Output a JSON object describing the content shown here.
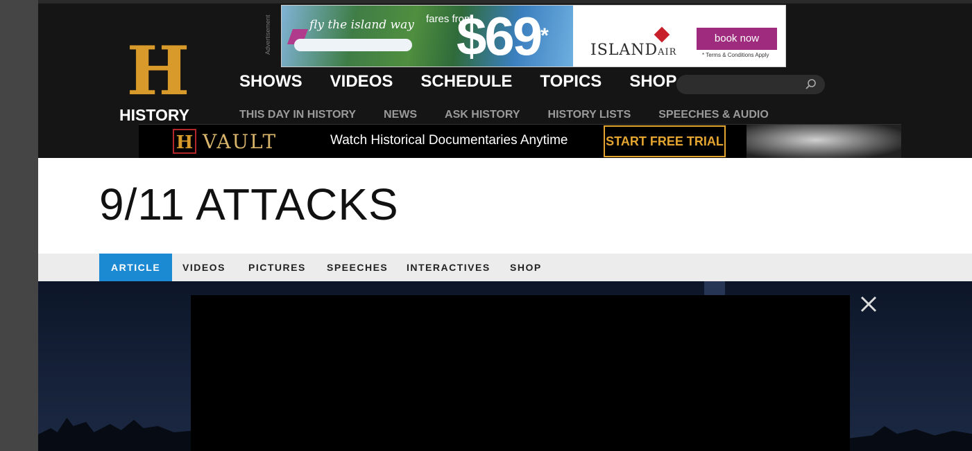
{
  "ad": {
    "label": "Advertisement",
    "tagline": "fly the island way",
    "fares_from": "fares from",
    "price": "$69",
    "price_mark": "*",
    "brand": "ISLAND",
    "brand_suffix": "AIR",
    "cta": "book now",
    "terms": "* Terms & Conditions Apply"
  },
  "logo": {
    "letter": "H",
    "text": "HISTORY"
  },
  "main_nav": [
    "SHOWS",
    "VIDEOS",
    "SCHEDULE",
    "TOPICS",
    "SHOP"
  ],
  "search": {
    "placeholder": ""
  },
  "sub_nav": [
    "THIS DAY IN HISTORY",
    "NEWS",
    "ASK HISTORY",
    "HISTORY LISTS",
    "SPEECHES & AUDIO"
  ],
  "vault": {
    "logo_letter": "H",
    "word": "VAULT",
    "tagline": "Watch Historical Documentaries Anytime",
    "cta": "START FREE TRIAL"
  },
  "page": {
    "title": "9/11 ATTACKS"
  },
  "tabs": [
    "ARTICLE",
    "VIDEOS",
    "PICTURES",
    "SPEECHES",
    "INTERACTIVES",
    "SHOP"
  ],
  "colors": {
    "accent_blue": "#1c8ad2",
    "vault_gold": "#e4a530",
    "ad_purple": "#9e2b7e",
    "logo_gold": "#d79a2b"
  }
}
